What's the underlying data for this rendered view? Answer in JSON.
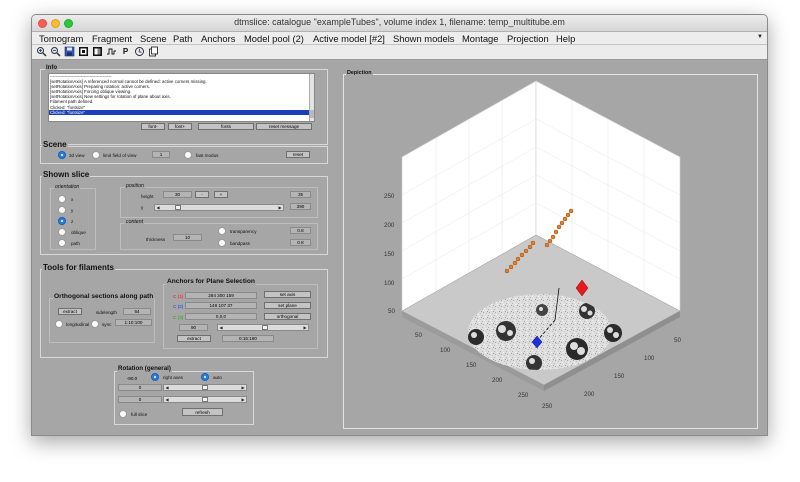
{
  "window": {
    "title": "dtmslice: catalogue \"exampleTubes\", volume index 1, filename: temp_multitube.em"
  },
  "menu": [
    "Tomogram",
    "Fragment",
    "Scene",
    "Path",
    "Anchors",
    "Model pool (2)",
    "Active model [#2]",
    "Shown models",
    "Montage",
    "Projection",
    "Help"
  ],
  "toolbar": {
    "icons": [
      "zoom-in-icon",
      "zoom-out-icon",
      "save-icon",
      "contrast-icon",
      "contrast-alt-icon",
      "waveform-icon",
      "p-icon",
      "history-icon",
      "copy-icon"
    ],
    "p_label": "P"
  },
  "info": {
    "title": "Info",
    "lines": [
      "------------------------------------------",
      "[setRotationAxis] A referenced normal cannot be defined: active corners missing.",
      "[setRotationAxis] Preparing rotation: active corners.",
      "[setRotationAxis] Forcing oblique viewing.",
      "[setRotationAxis] New settings for rotation of plane about axis.",
      "Filament path defined.",
      "Clicked: \"fontsize\"",
      "Clicked: \"fontsize\""
    ],
    "buttons": [
      "font-",
      "font+",
      "fonts",
      "reset message"
    ]
  },
  "scene": {
    "title": "Scene",
    "option_3d": "3d view",
    "option_limit": "limit field of view",
    "limit_value": "1",
    "option_fast": "fast modus",
    "reset": "reset"
  },
  "shown_slice": {
    "title": "Shown slice",
    "orientation": {
      "title": "orientation",
      "options": [
        "x",
        "y",
        "z",
        "oblique",
        "path"
      ],
      "selected": "z"
    },
    "position": {
      "title": "position",
      "height_label": "height",
      "height_value": "30",
      "minus": "-",
      "plus": "+",
      "max_value": "35",
      "y_label": "y",
      "y_max": "390"
    },
    "content": {
      "title": "content",
      "thickness_label": "thickness",
      "thickness_value": "10",
      "transparency_label": "transparency",
      "transparency_value": "0.8",
      "bandpass_label": "bandpass",
      "bandpass_value": "0.8"
    }
  },
  "tools": {
    "title": "Tools for filaments",
    "orth": {
      "title": "Orthogonal sections along path",
      "extract": "extract",
      "sidelength_label": "sidelength",
      "sidelength_value": "64",
      "longitudinal": "longitudinal",
      "sync": "sync",
      "sync_value": "1:10:100"
    },
    "anchors": {
      "title": "Anchors for Plane Selection",
      "c1_label": "C (1)",
      "c1_value": "284 300 159",
      "c2_label": "C (2)",
      "c2_value": "148 107 37",
      "c3_label": "C (3)",
      "c3_value": "0,0,0",
      "set_axis": "set axis",
      "set_plane": "set plane",
      "orthogonal": "orthogonal",
      "angle_value": "90",
      "extract": "extract",
      "range_value": "0:15:180",
      "c1_color": "#d81c1c",
      "c2_color": "#1c3fd8",
      "c3_color": "#2aa02a"
    }
  },
  "rotation": {
    "title": "Rotation (general)",
    "value1": "-90.0",
    "right_axes": "right axes",
    "auto": "auto",
    "value2": "0",
    "value3": "0",
    "full_slice": "full slice",
    "refresh": "refresh"
  },
  "depiction": {
    "title": "Depiction",
    "axis_z_ticks": [
      "250",
      "200",
      "150",
      "100",
      "50"
    ],
    "axis_x_ticks": [
      "50",
      "100",
      "150",
      "200",
      "250"
    ],
    "axis_y_ticks": [
      "250",
      "200",
      "150",
      "100",
      "50"
    ]
  }
}
